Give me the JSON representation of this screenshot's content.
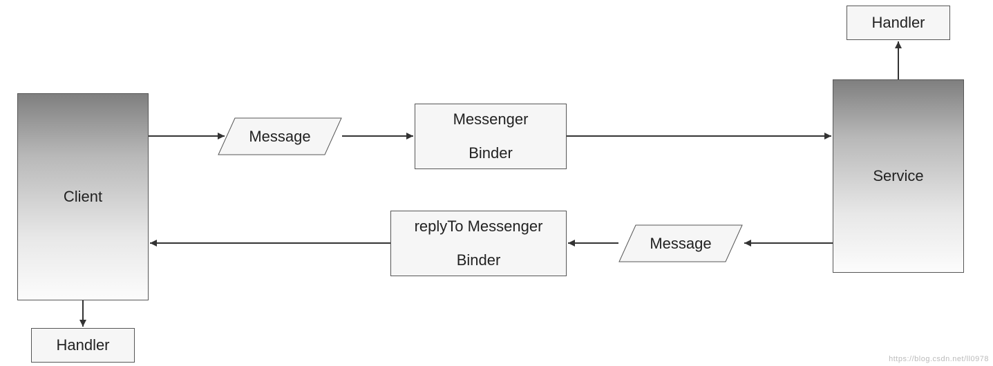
{
  "nodes": {
    "client": "Client",
    "service": "Service",
    "handler_top": "Handler",
    "handler_bottom": "Handler",
    "message_top": "Message",
    "message_bottom": "Message",
    "messenger_binder_l1": "Messenger",
    "messenger_binder_l2": "Binder",
    "reply_binder_l1": "replyTo  Messenger",
    "reply_binder_l2": "Binder"
  },
  "watermark": "https://blog.csdn.net/ll0978"
}
